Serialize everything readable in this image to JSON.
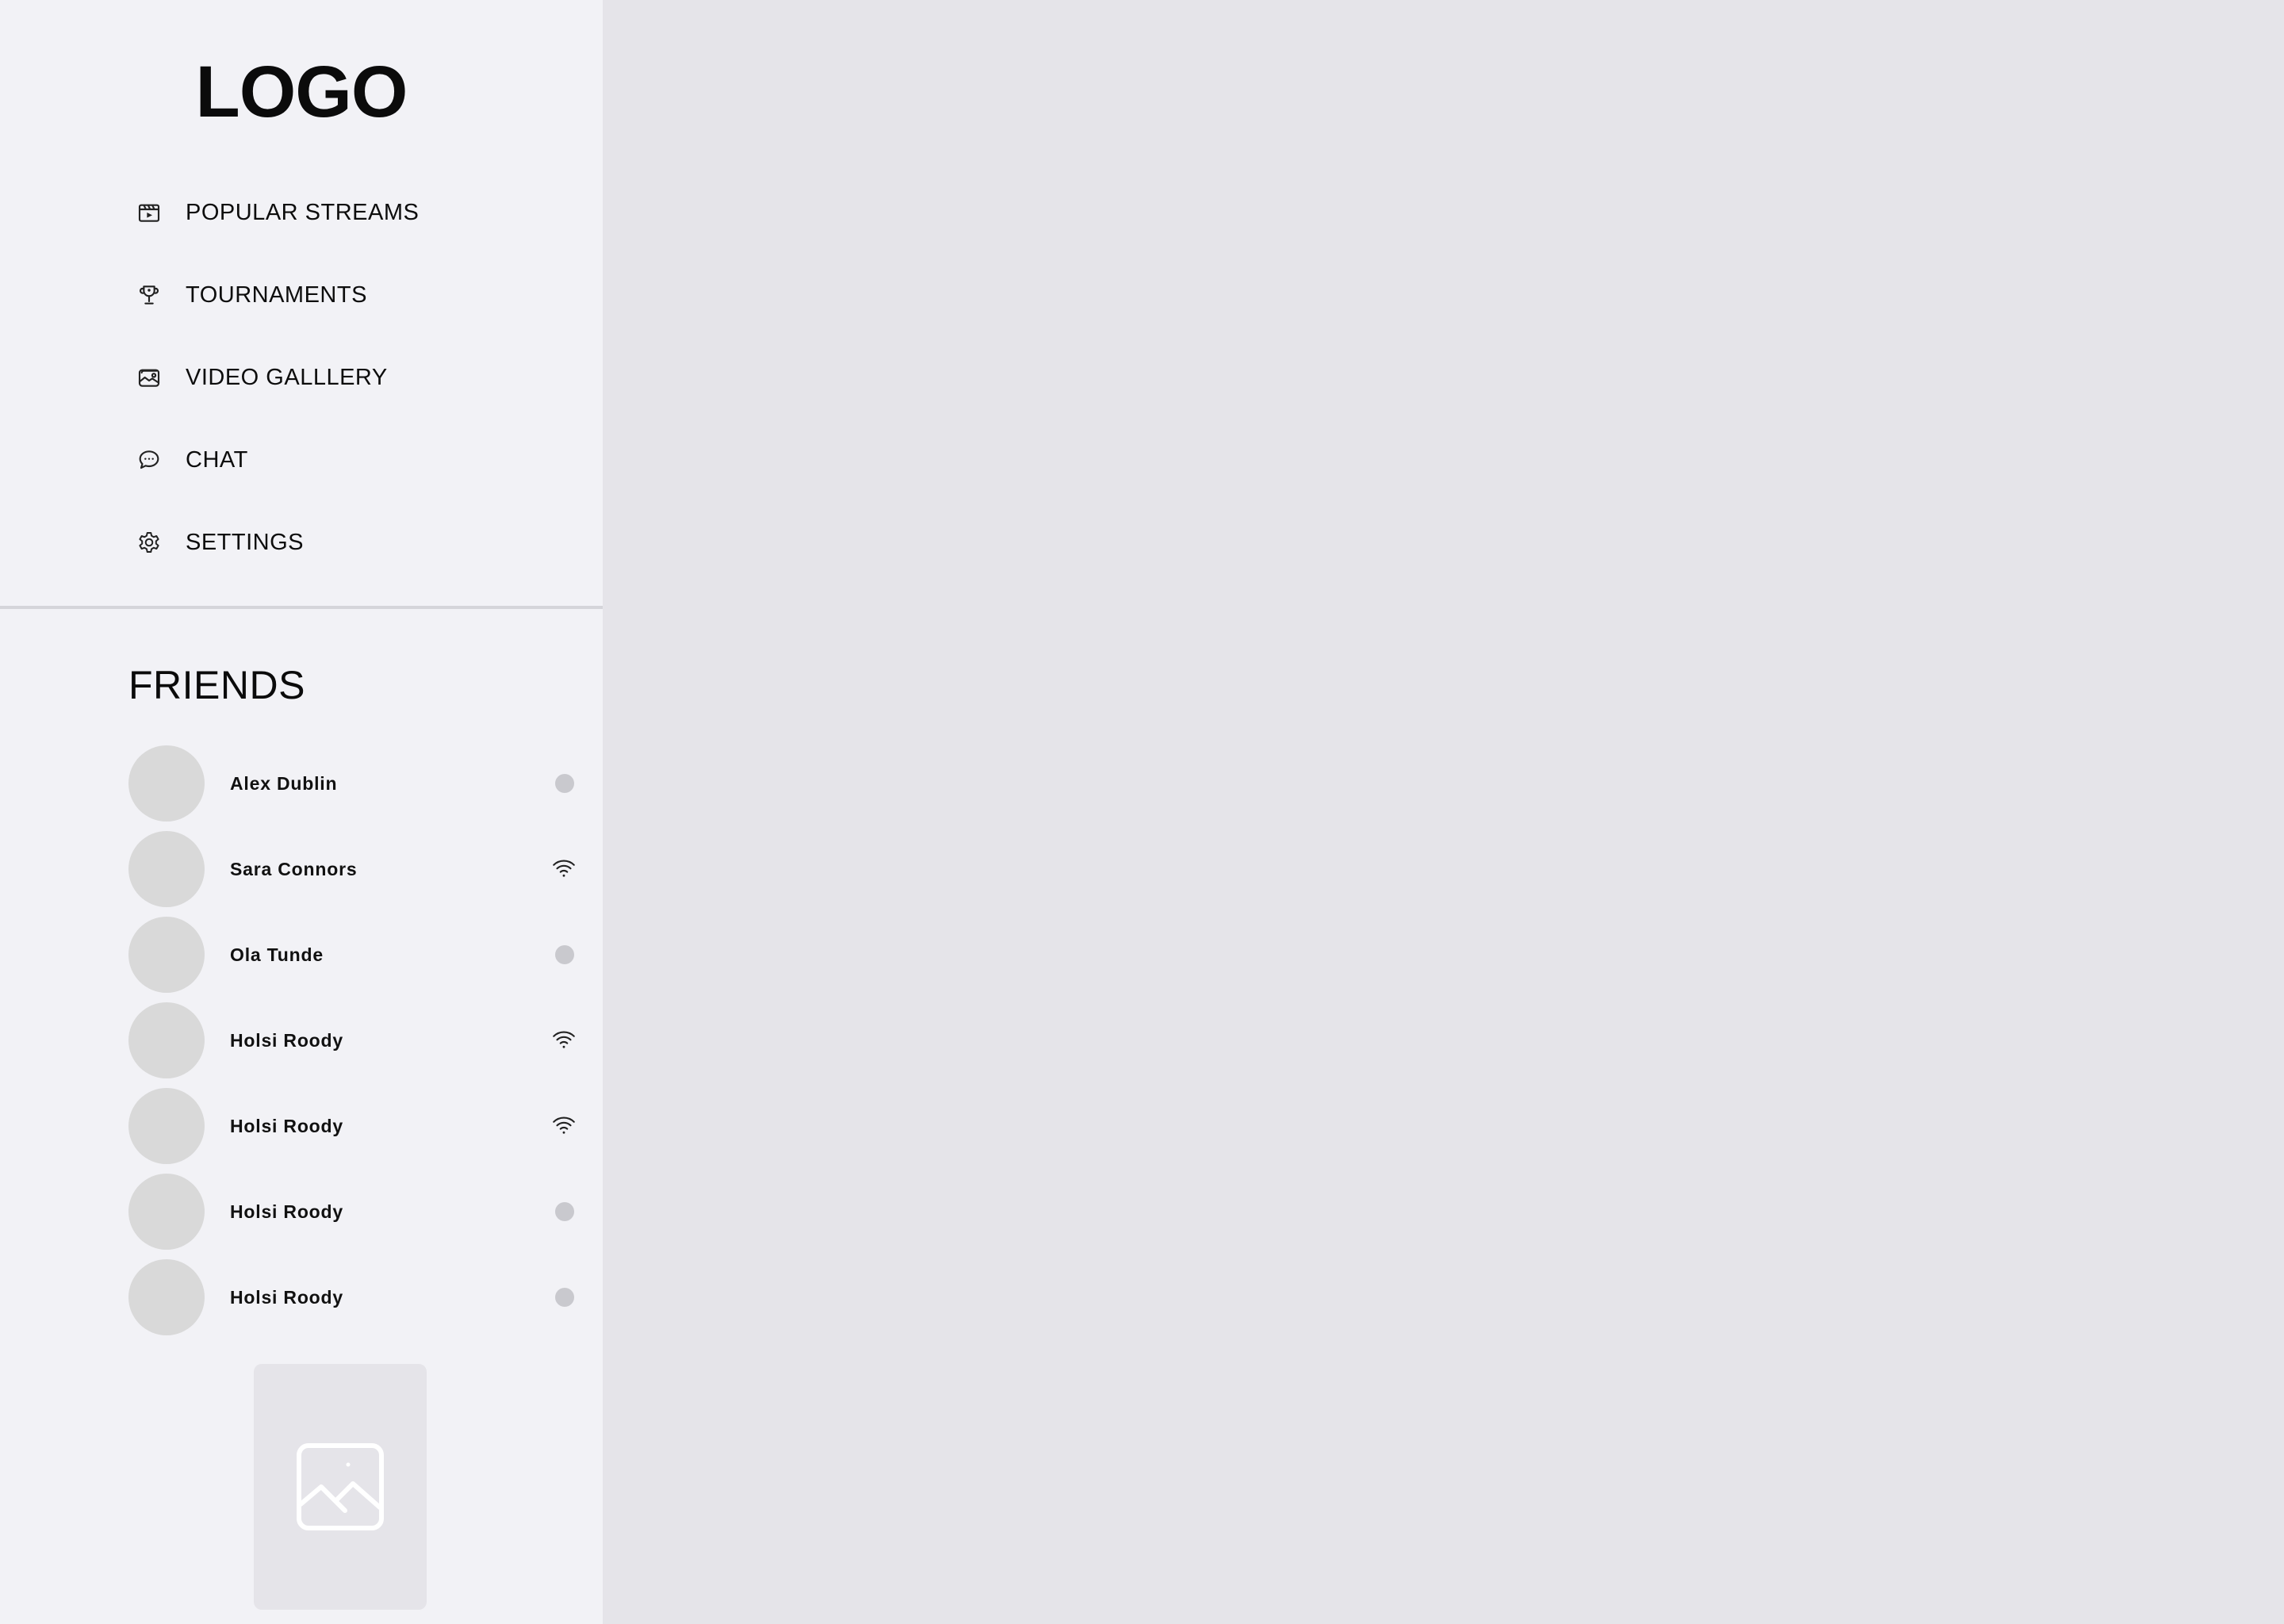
{
  "sidebar": {
    "logo": "LOGO",
    "nav": [
      {
        "label": "POPULAR STREAMS",
        "icon": "clapperboard-icon"
      },
      {
        "label": "TOURNAMENTS",
        "icon": "trophy-icon"
      },
      {
        "label": "VIDEO GALLLERY",
        "icon": "gallery-icon"
      },
      {
        "label": "CHAT",
        "icon": "chat-bubble-icon"
      },
      {
        "label": "SETTINGS",
        "icon": "gear-icon"
      }
    ],
    "friends": {
      "title": "FRIENDS",
      "list": [
        {
          "name": "Alex Dublin",
          "status": "offline"
        },
        {
          "name": "Sara Connors",
          "status": "streaming"
        },
        {
          "name": "Ola Tunde",
          "status": "offline"
        },
        {
          "name": "Holsi Roody",
          "status": "streaming"
        },
        {
          "name": "Holsi Roody",
          "status": "streaming"
        },
        {
          "name": "Holsi Roody",
          "status": "offline"
        },
        {
          "name": "Holsi Roody",
          "status": "offline"
        }
      ]
    },
    "promo_image": {
      "icon": "image-placeholder-icon"
    }
  },
  "colors": {
    "sidebar_bg": "#f2f2f6",
    "main_bg": "#e5e4e9",
    "avatar": "#d9d9d9",
    "status_dot": "#c9c9ce",
    "text": "#111111"
  }
}
